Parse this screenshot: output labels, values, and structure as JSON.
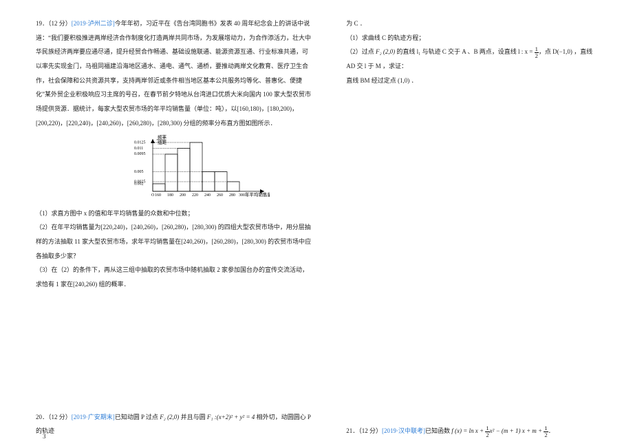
{
  "left": {
    "q19": {
      "label": "19．（12 分）",
      "source_text": "[2019·泸州二诊]",
      "text": "今年年初，习近平在《告台湾同胞书》发表 40 周年纪念会上的讲话中说道：“我们要积极推进两岸经济合作制度化打造两岸共同市场，为发展增动力，为合作添活力，壮大中华民族经济两岸要应通尽通，提升经贸合作畅通、基础设施联通、能源资源互通、行业标准共通，可以率先实现金门，马祖同福建沿海地区通水、通电、通气、通桥，要推动两岸文化教育、医疗卫生合作，社会保障和公共资源共享，支持两岸邻近或条件相当地区基本公共服务均等化、普惠化、便捷化”某外贸企业积极响应习主席的号召，在春节前夕特地从台湾进口优质大米向国内 100 家大型农贸市场提供货源．据统计，每家大型农贸市场的年平均销售量（单位：吨），以[160,180)，[180,200)，[200,220)，[220,240)，[240,260)，[260,280)，[280,300) 分组的频率分布直方图如图所示．",
      "sub1": "（1）求直方图中 x 的值和年平均销售量的众数和中位数；",
      "sub2": "（2）在年平均销售量为[220,240)，[240,260)，[260,280)，[280,300) 的四组大型农贸市场中，用分层抽样的方法抽取 11 家大型农贸市场，求年平均销售量在[240,260)，[260,280)，[280,300) 的农贸市场中应各抽取多少家？",
      "sub3": "（3）在（2）的条件下，再从这三组中抽取的农贸市场中随机抽取 2 家参加国台办的宣传交流活动，求恰有 1 家在[240,260) 组的概率．"
    },
    "q20": {
      "label": "20．（12 分）",
      "source_text": "[2019·广安期末]",
      "text_prefix": "已知动圆 P 过点 ",
      "f2": "F₂ (2,0)",
      "mid": " 并且与圆 ",
      "f1eq": "F₁ :(x+2)² + y² = 4",
      "tail": " 相外切，动圆圆心 P 的轨迹"
    },
    "page": "3"
  },
  "right": {
    "continue1": "为 C ．",
    "sub1": "（1）求曲线 C 的轨迹方程；",
    "sub2_prefix": "（2）过点 ",
    "sub2_f2": "F₂ (2,0)",
    "sub2_mid1": " 的直线 l₁ 与轨迹 C 交于 A 、B 两点，设直线 l : x = ",
    "sub2_mid2": "，点 D(−1,0) ，直线 AD 交 l 于 M ，求证：",
    "sub2_line2": "直线 BM 经过定点 (1,0) ．",
    "q21": {
      "label": "21．（12 分）",
      "source_text": "[2019·汉中联考]",
      "text_prefix": "已知函数 ",
      "eq_before": "f (x) = ln x + ",
      "eq_middle": "x² − (m + 1) x + m + ",
      "tail": "．"
    }
  },
  "chart_data": {
    "type": "bar",
    "title_line1": "频率",
    "title_line2": "组距",
    "categories": [
      160,
      180,
      200,
      220,
      240,
      260,
      280,
      300
    ],
    "values": [
      0.002,
      0.0095,
      0.011,
      0.0125,
      0.005,
      0.005,
      0.0025
    ],
    "x_label": "年平均销售量/吨",
    "y_ticks": [
      0.002,
      0.0025,
      0.005,
      0.0095,
      0.011,
      0.0125
    ]
  }
}
